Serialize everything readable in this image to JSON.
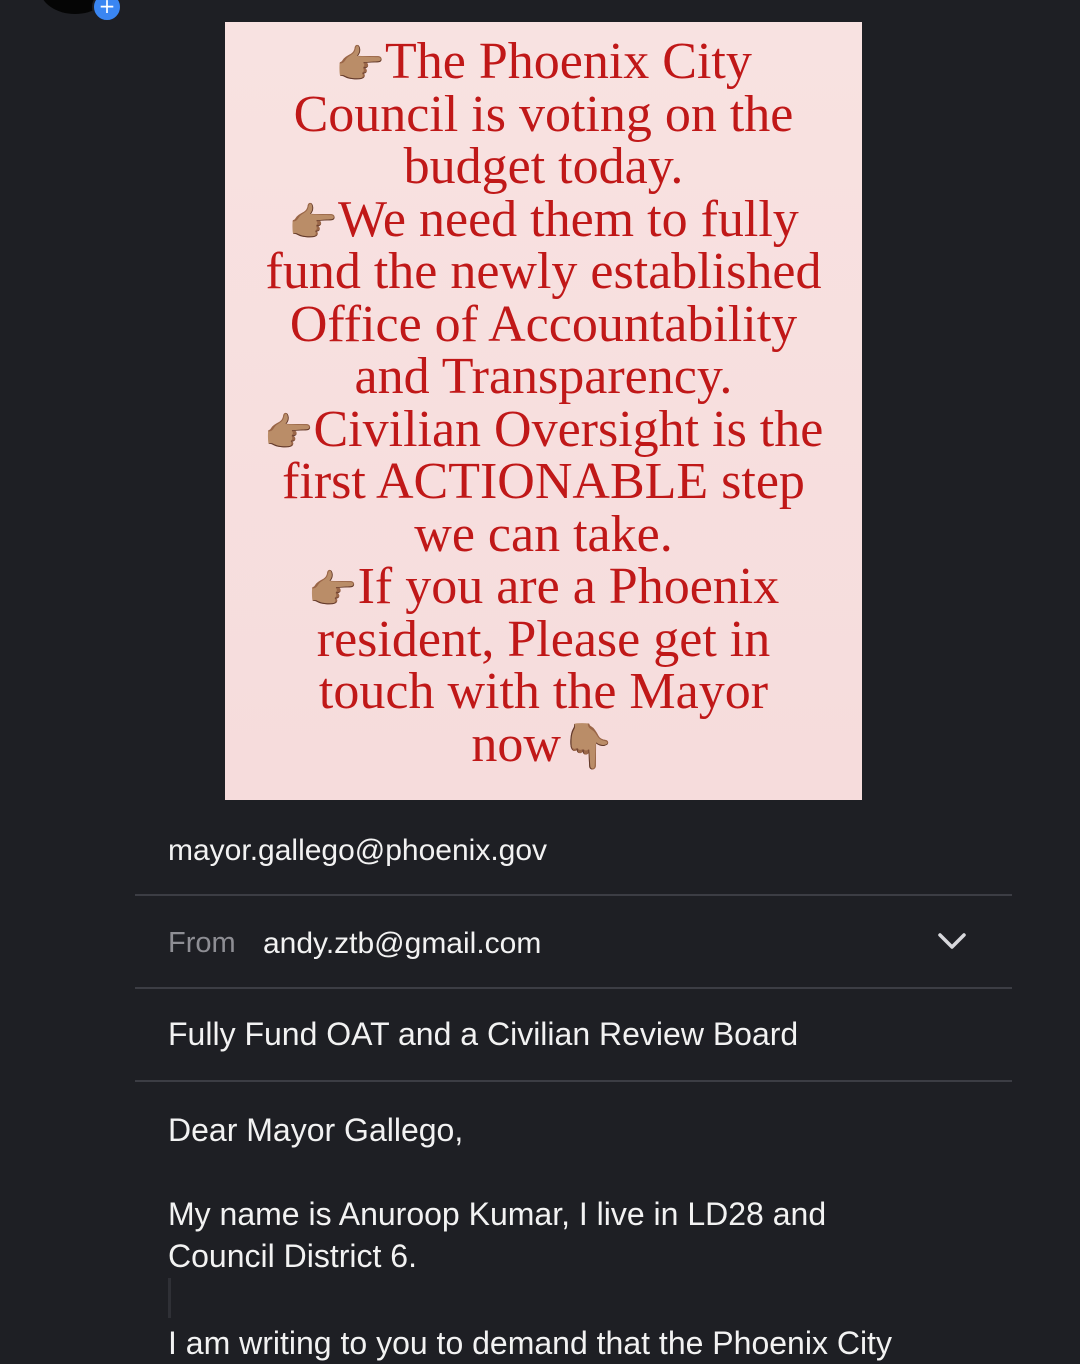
{
  "flyer": {
    "lines": [
      {
        "pointer": "👉🏽",
        "text": "The Phoenix City"
      },
      {
        "pointer": "",
        "text": "Council is voting on the"
      },
      {
        "pointer": "",
        "text": "budget today."
      },
      {
        "pointer": "👉🏽",
        "text": "We need them to fully"
      },
      {
        "pointer": "",
        "text": "fund the newly established"
      },
      {
        "pointer": "",
        "text": "Office of Accountability"
      },
      {
        "pointer": "",
        "text": "and Transparency."
      },
      {
        "pointer": "👉🏽",
        "text": "Civilian Oversight is the"
      },
      {
        "pointer": "",
        "text": "first ACTIONABLE step"
      },
      {
        "pointer": "",
        "text": "we can take."
      },
      {
        "pointer": "👉🏽",
        "text": "If you are a Phoenix"
      },
      {
        "pointer": "",
        "text": "resident, Please get in"
      },
      {
        "pointer": "",
        "text": "touch with the Mayor"
      },
      {
        "pointer": "",
        "text": "now"
      }
    ],
    "end_pointer": "👇🏽",
    "text_color": "#c01818",
    "background": "#f7dfde"
  },
  "email": {
    "to": "mayor.gallego@phoenix.gov",
    "from_label": "From",
    "from": "andy.ztb@gmail.com",
    "subject": "Fully Fund OAT and a Civilian Review Board",
    "body": {
      "greeting": "Dear Mayor Gallego,",
      "intro_line1": "My name is Anuroop Kumar, I live in LD28 and",
      "intro_line2": "Council District 6.",
      "partial_line": "I am writing to you to demand that the Phoenix City"
    },
    "icons": {
      "from_dropdown": "chevron-down-icon",
      "avatar_add": "plus-icon"
    }
  }
}
